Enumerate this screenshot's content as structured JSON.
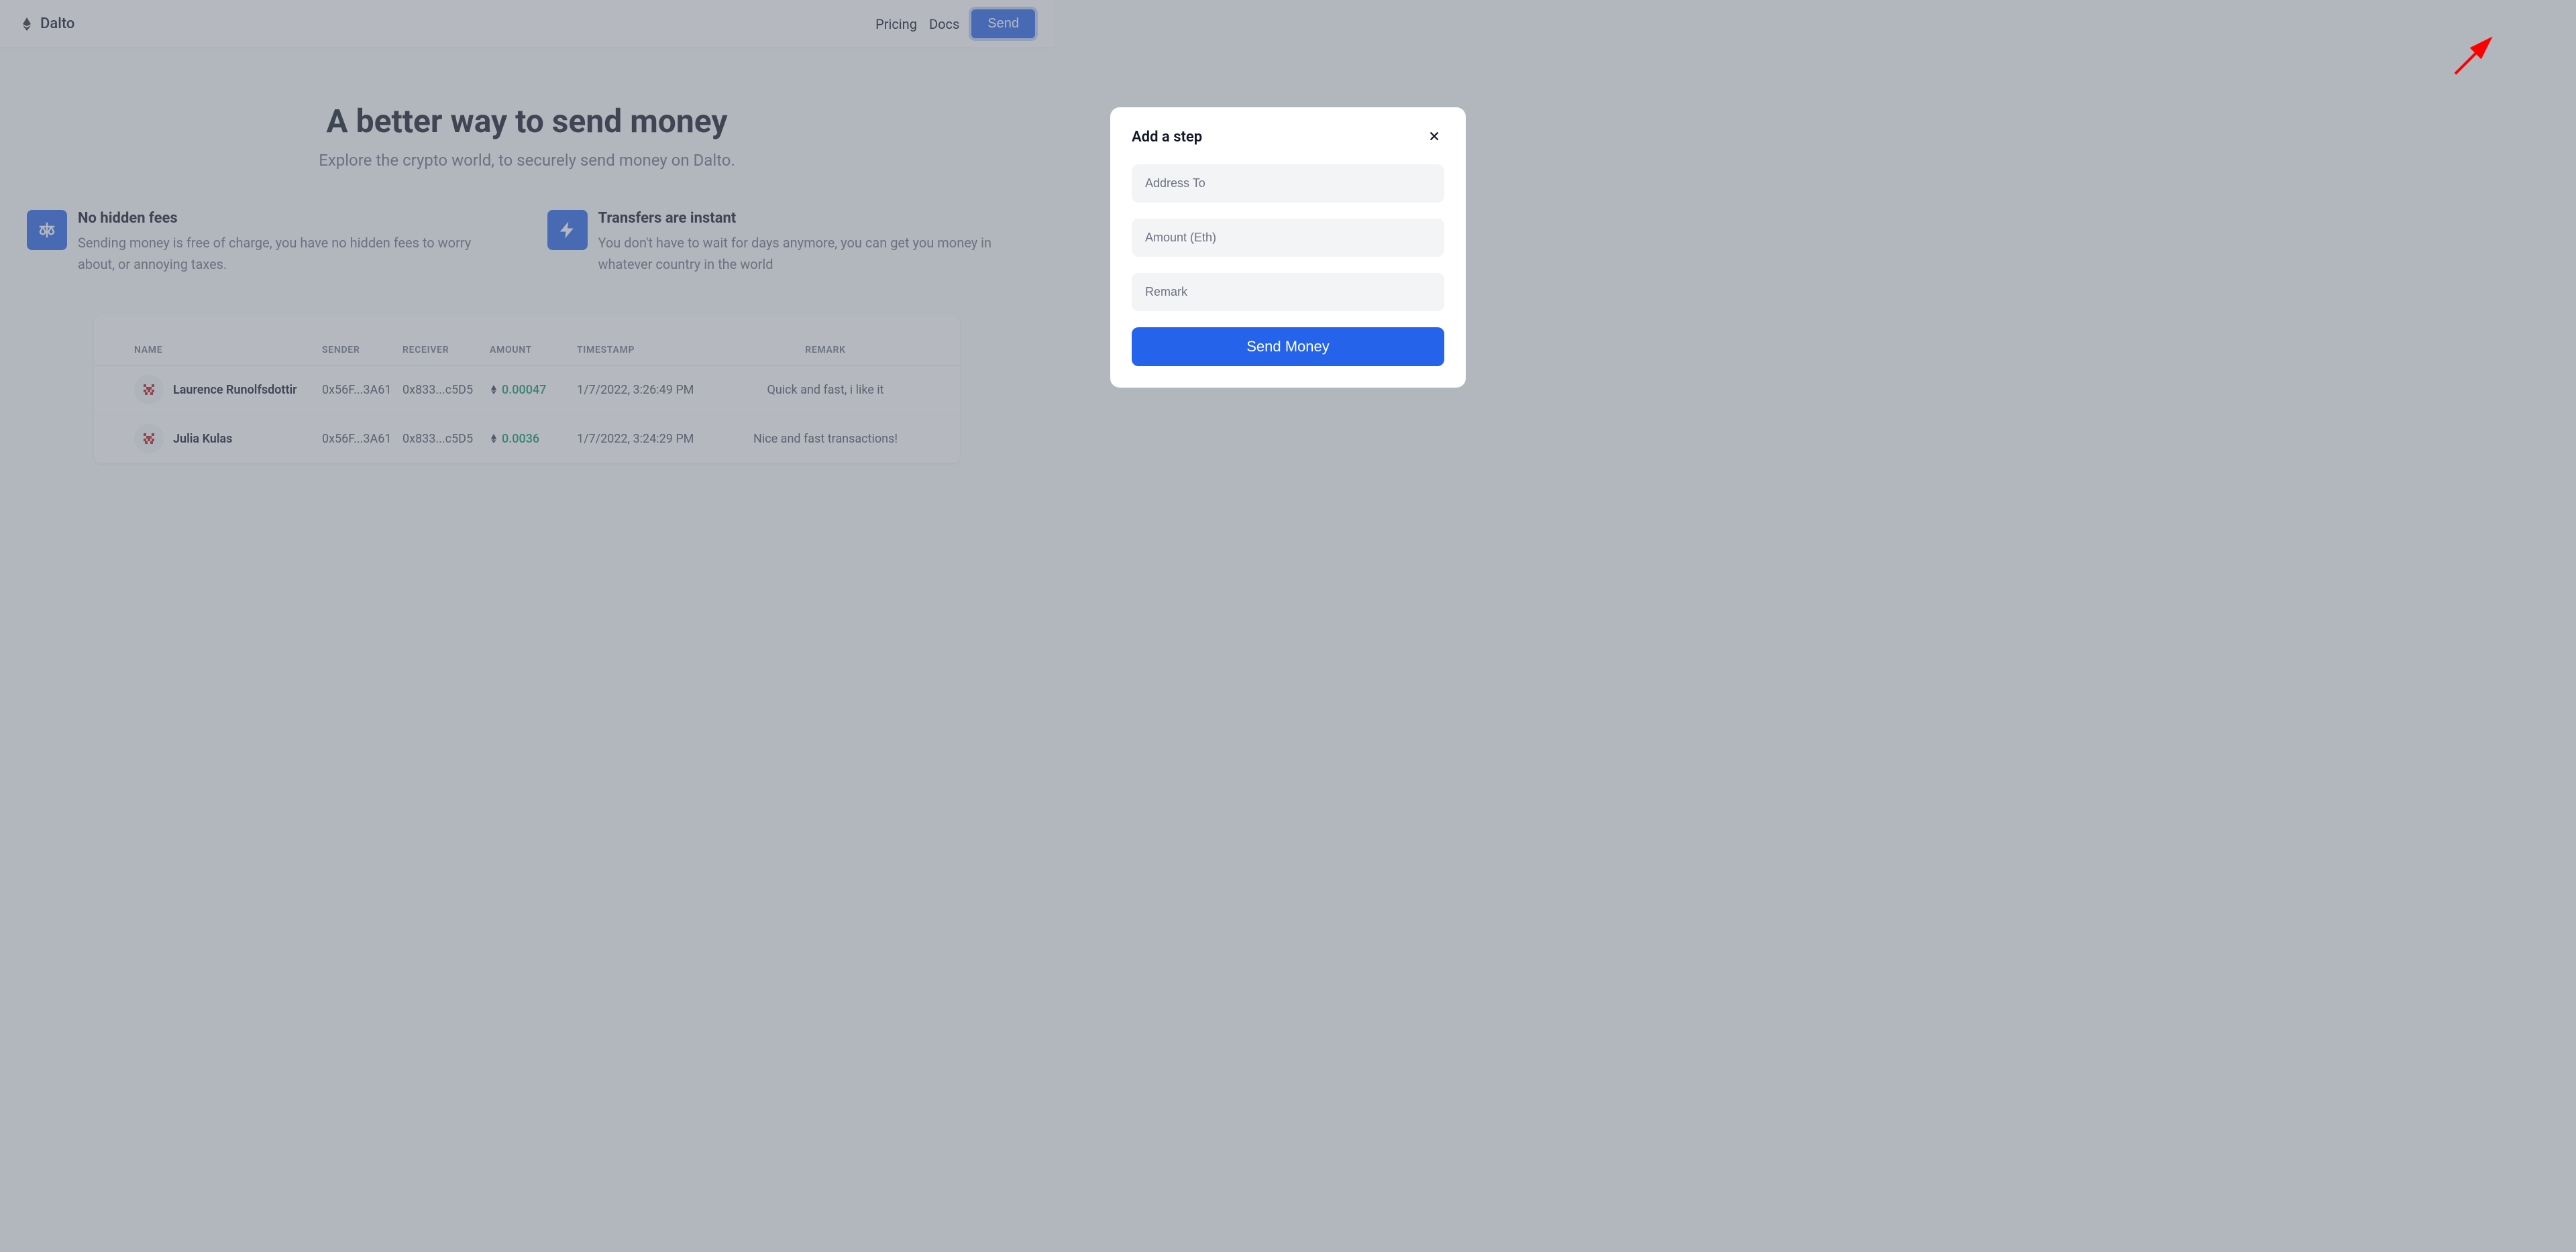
{
  "brand": {
    "name": "Dalto"
  },
  "nav": {
    "pricing": "Pricing",
    "docs": "Docs",
    "send": "Send"
  },
  "hero": {
    "title": "A better way to send money",
    "subtitle": "Explore the crypto world, to securely send money on Dalto."
  },
  "features": {
    "fees": {
      "title": "No hidden fees",
      "desc": "Sending money is free of charge, you have no hidden fees to worry about, or annoying taxes."
    },
    "instant": {
      "title": "Transfers are instant",
      "desc": "You don't have to wait for days anymore, you can get you money in whatever country in the world"
    }
  },
  "table": {
    "headers": {
      "name": "NAME",
      "sender": "SENDER",
      "receiver": "RECEIVER",
      "amount": "AMOUNT",
      "timestamp": "TIMESTAMP",
      "remark": "REMARK"
    },
    "rows": [
      {
        "name": "Laurence Runolfsdottir",
        "sender": "0x56F...3A61",
        "receiver": "0x833...c5D5",
        "amount": "0.00047",
        "timestamp": "1/7/2022, 3:26:49 PM",
        "remark": "Quick and fast, i like it"
      },
      {
        "name": "Julia Kulas",
        "sender": "0x56F...3A61",
        "receiver": "0x833...c5D5",
        "amount": "0.0036",
        "timestamp": "1/7/2022, 3:24:29 PM",
        "remark": "Nice and fast transactions!"
      }
    ]
  },
  "modal": {
    "title": "Add a step",
    "placeholders": {
      "address": "Address To",
      "amount": "Amount (Eth)",
      "remark": "Remark"
    },
    "button": "Send Money"
  }
}
